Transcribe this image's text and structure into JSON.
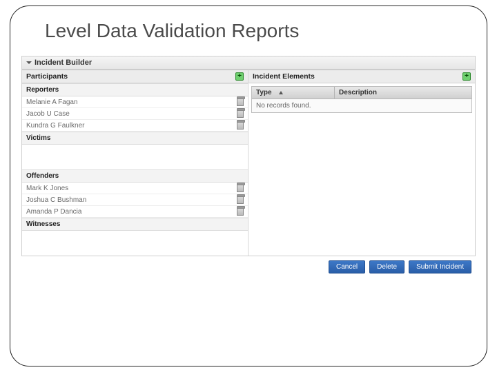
{
  "title": "Level Data Validation Reports",
  "builder": {
    "header": "Incident Builder",
    "participants": {
      "title": "Participants",
      "reporters": {
        "label": "Reporters",
        "people": [
          {
            "name": "Melanie A Fagan"
          },
          {
            "name": "Jacob U Case"
          },
          {
            "name": "Kundra G Faulkner"
          }
        ]
      },
      "victims": {
        "label": "Victims"
      },
      "offenders": {
        "label": "Offenders",
        "people": [
          {
            "name": "Mark K Jones"
          },
          {
            "name": "Joshua C Bushman"
          },
          {
            "name": "Amanda P Dancia"
          }
        ]
      },
      "witnesses": {
        "label": "Witnesses"
      }
    },
    "elements": {
      "title": "Incident Elements",
      "col_type": "Type",
      "col_desc": "Description",
      "empty": "No records found."
    }
  },
  "buttons": {
    "cancel": "Cancel",
    "delete": "Delete",
    "submit": "Submit Incident"
  }
}
